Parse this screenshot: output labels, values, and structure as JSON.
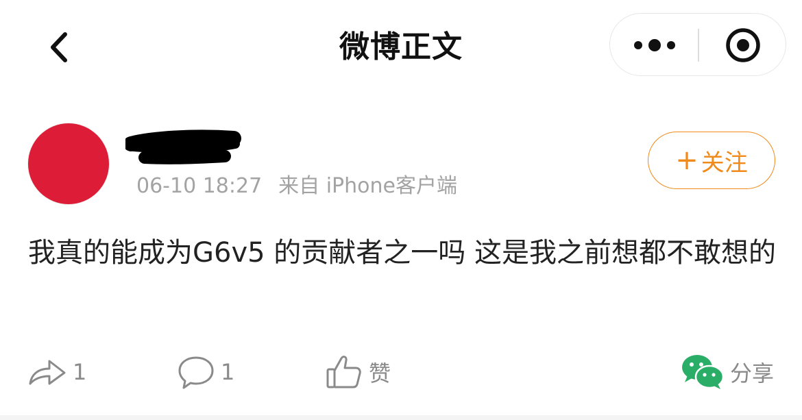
{
  "navbar": {
    "title": "微博正文",
    "back_icon": "chevron-left-icon",
    "more_icon": "more-dots-icon",
    "close_icon": "target-circle-icon"
  },
  "post": {
    "time": "06-10 18:27",
    "source": "来自 iPhone客户端",
    "follow_label": "关注",
    "text": "我真的能成为G6v5 的贡献者之一吗 这是我之前想都不敢想的",
    "avatar_color": "#dd1c37"
  },
  "actions": {
    "repost_count": "1",
    "comment_count": "1",
    "like_label": "赞",
    "share_label": "分享"
  },
  "colors": {
    "accent": "#f08a1a",
    "wechat_green": "#2aae67",
    "meta_text": "#a3a3a3",
    "icon_gray": "#8a8a8a"
  }
}
